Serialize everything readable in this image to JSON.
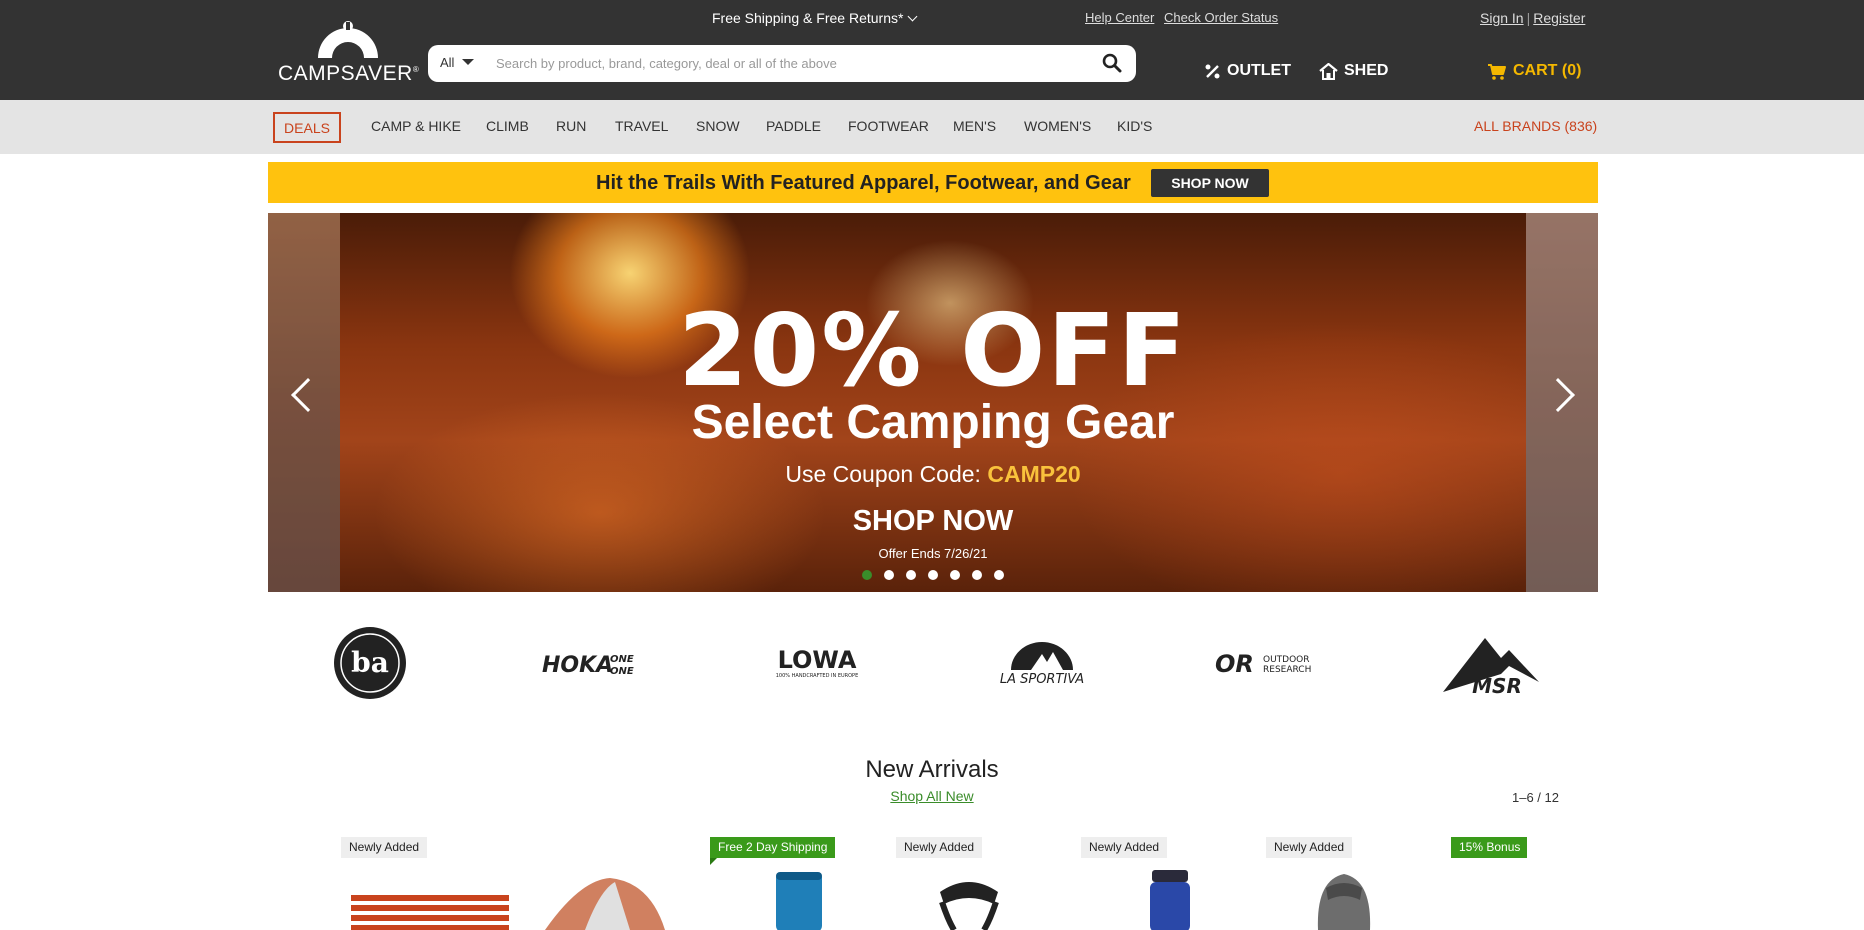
{
  "header": {
    "logo": "CAMPSAVER",
    "shipping": "Free Shipping & Free Returns*",
    "help_center": "Help Center",
    "check_order": "Check Order Status",
    "sign_in": "Sign In",
    "separator": "|",
    "register": "Register",
    "outlet": "OUTLET",
    "shed": "SHED",
    "cart": "CART (0)"
  },
  "search": {
    "category": "All",
    "placeholder": "Search by product, brand, category, deal or all of the above"
  },
  "categories": {
    "deals": "DEALS",
    "items": [
      "CAMP & HIKE",
      "CLIMB",
      "RUN",
      "TRAVEL",
      "SNOW",
      "PADDLE",
      "FOOTWEAR",
      "MEN'S",
      "WOMEN'S",
      "KID'S"
    ],
    "all_brands": "ALL BRANDS (836)"
  },
  "promo": {
    "text": "Hit the Trails With Featured Apparel, Footwear, and Gear",
    "button": "SHOP NOW"
  },
  "hero": {
    "headline": "20% OFF",
    "subhead": "Select Camping Gear",
    "coupon_prefix": "Use Coupon Code:",
    "coupon_code": "CAMP20",
    "cta": "SHOP NOW",
    "offer_ends": "Offer Ends 7/26/21",
    "slide_count": 7,
    "active_slide": 1
  },
  "brands": [
    "Big Agnes",
    "HOKA ONE ONE",
    "LOWA",
    "LA SPORTIVA",
    "OUTDOOR RESEARCH",
    "MSR"
  ],
  "new_arrivals": {
    "title": "New Arrivals",
    "link": "Shop All New",
    "count": "1–6 / 12",
    "badges": [
      "Newly Added",
      "Free 2 Day Shipping",
      "Newly Added",
      "Newly Added",
      "Newly Added",
      "15% Bonus"
    ]
  },
  "colors": {
    "accent_red": "#c9431d",
    "promo_yellow": "#ffc20e",
    "cart_yellow": "#f5b800",
    "green": "#3a8c2a"
  }
}
